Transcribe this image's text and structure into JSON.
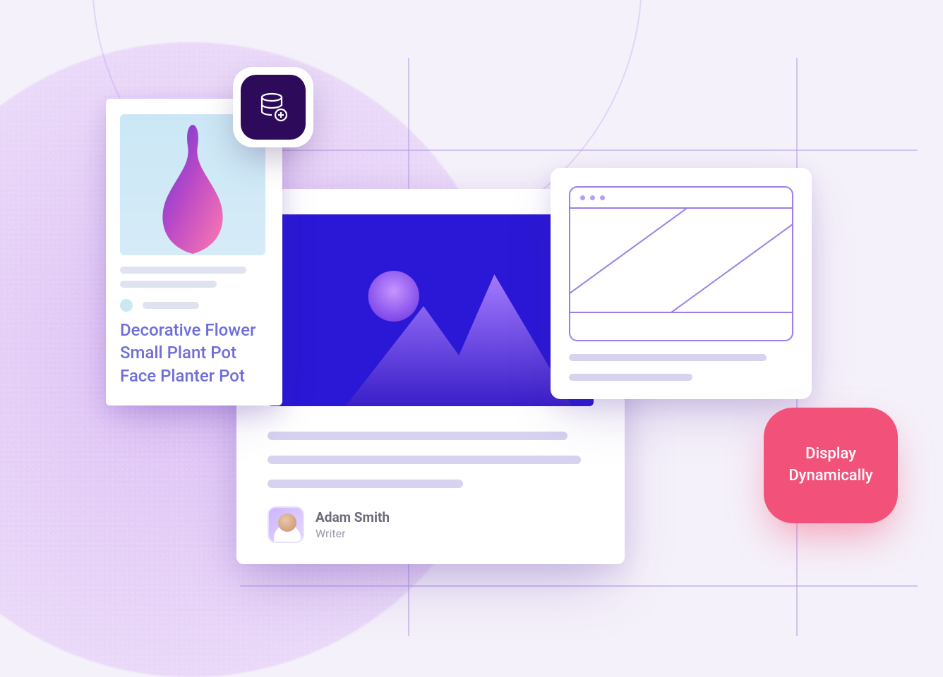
{
  "product_card": {
    "title": "Decorative Flower Small Plant Pot Face Planter Pot"
  },
  "article_card": {
    "author_name": "Adam Smith",
    "author_role": "Writer"
  },
  "cta": {
    "label": "Display\nDynamically"
  },
  "icons": {
    "database_badge": "database-add-icon"
  }
}
